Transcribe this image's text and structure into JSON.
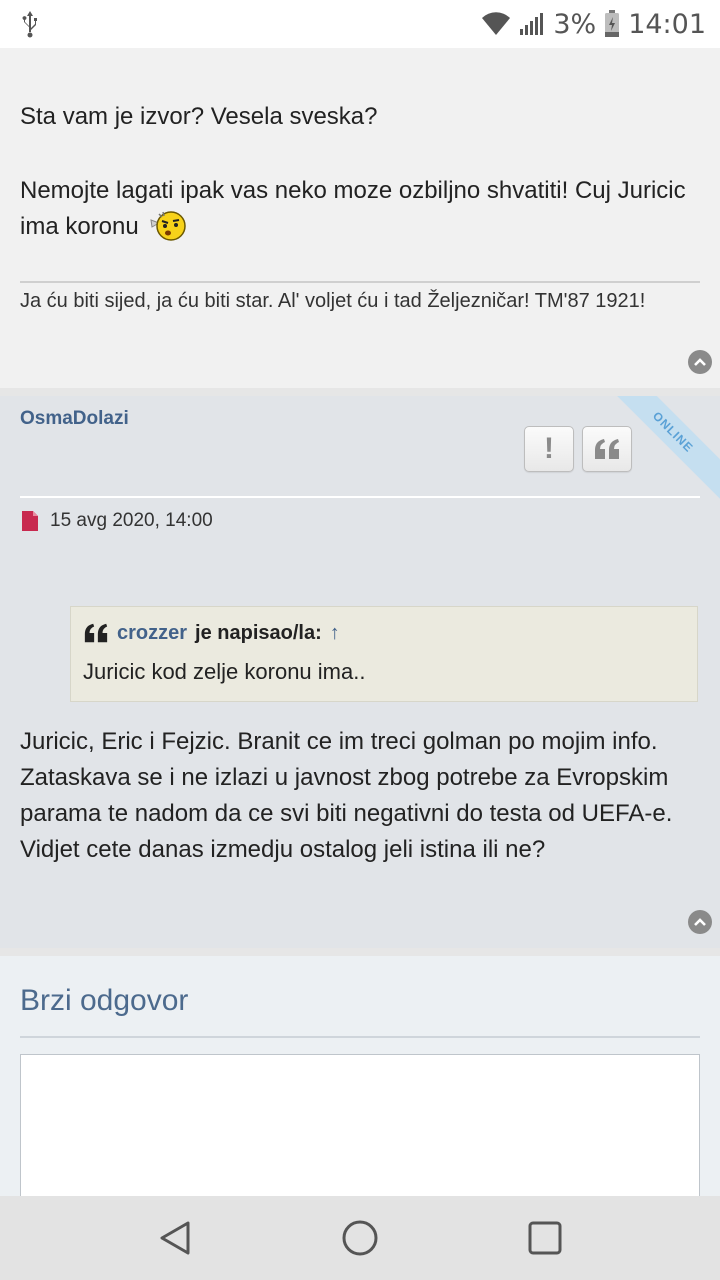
{
  "status_bar": {
    "battery_percent": "3%",
    "time": "14:01",
    "icons": [
      "usb-icon",
      "wifi-icon",
      "signal-icon",
      "battery-icon"
    ]
  },
  "post1": {
    "line1": "Sta vam je izvor? Vesela sveska?",
    "line2": "Nemojte lagati ipak vas neko moze ozbiljno shvatiti! Cuj Juricic ima koronu",
    "signature": "Ja ću biti sijed, ja ću biti star. Al' voljet ću i tad Željezničar! TM'87 1921!"
  },
  "post2": {
    "author": "OsmaDolazi",
    "online_badge": "ONLINE",
    "report_glyph": "!",
    "quote_glyph": "❝",
    "date": "15 avg 2020, 14:00",
    "quote": {
      "user": "crozzer",
      "said": "je napisao/la:",
      "arrow": "↑",
      "text": "Juricic kod zelje koronu ima.."
    },
    "body": "Juricic, Eric i Fejzic. Branit ce im treci golman po mojim info. Zataskava se i ne izlazi u javnost zbog potrebe za Evropskim parama te nadom da ce svi biti negativni do testa od UEFA-e. Vidjet cete danas izmedju ostalog jeli istina ili ne?"
  },
  "quick_reply": {
    "title": "Brzi odgovor",
    "message": ""
  },
  "colors": {
    "link": "#42628a",
    "post_bg": "#e1e4e8",
    "quote_bg": "#ebeadf",
    "online": "#5aa1d6"
  }
}
